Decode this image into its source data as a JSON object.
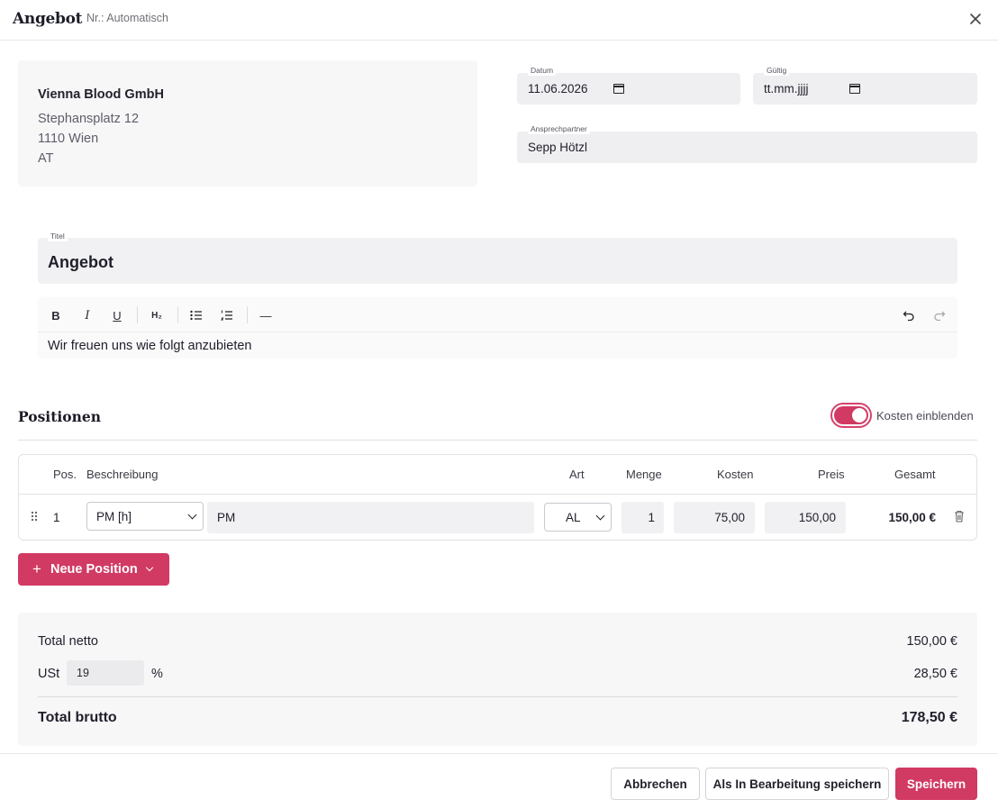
{
  "header": {
    "title": "Angebot",
    "number_label": "Nr.: Automatisch",
    "close_icon": "close-icon"
  },
  "customer": {
    "company": "Vienna Blood GmbH",
    "street": "Stephansplatz 12",
    "city": "1110 Wien",
    "country": "AT"
  },
  "fields": {
    "datum_label": "Datum",
    "datum_value": "11.06.2026",
    "gueltig_label": "Gültig",
    "gueltig_value": "tt.mm.jjjj",
    "ansprechpartner_label": "Ansprechpartner",
    "ansprechpartner_value": "Sepp Hötzl",
    "titel_label": "Titel",
    "titel_value": "Angebot"
  },
  "editor": {
    "toolbar": {
      "bold": "B",
      "italic": "I",
      "underline": "U",
      "heading": "H₂",
      "divider": "—"
    },
    "content": "Wir freuen uns wie folgt anzubieten"
  },
  "positionen": {
    "title": "Positionen",
    "toggle_label": "Kosten einblenden",
    "toggle_on": true,
    "columns": {
      "pos": "Pos.",
      "beschreibung": "Beschreibung",
      "art": "Art",
      "menge": "Menge",
      "kosten": "Kosten",
      "preis": "Preis",
      "gesamt": "Gesamt"
    },
    "rows": [
      {
        "pos": "1",
        "type_select": "PM [h]",
        "description": "PM",
        "art": "AL",
        "menge": "1",
        "kosten": "75,00",
        "preis": "150,00",
        "gesamt": "150,00 €"
      }
    ],
    "new_button": "Neue Position"
  },
  "totals": {
    "netto_label": "Total netto",
    "netto_value": "150,00 €",
    "ust_label": "USt",
    "ust_rate": "19",
    "ust_percent": "%",
    "ust_value": "28,50 €",
    "brutto_label": "Total brutto",
    "brutto_value": "178,50 €"
  },
  "footer": {
    "cancel": "Abbrechen",
    "save_draft": "Als In Bearbeitung speichern",
    "save": "Speichern"
  },
  "colors": {
    "accent": "#d13a63"
  }
}
